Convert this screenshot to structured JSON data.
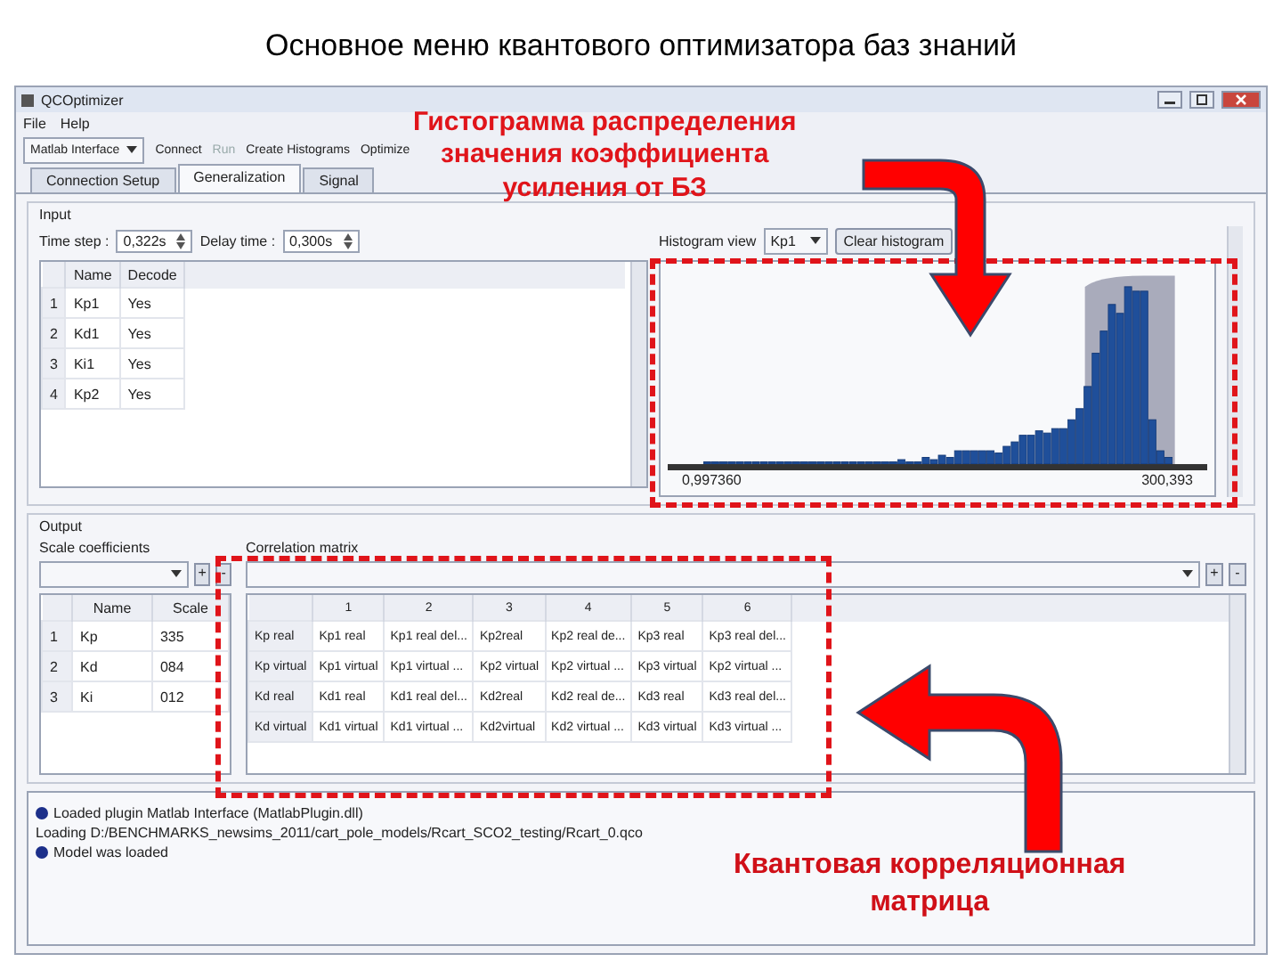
{
  "slide_title": "Основное меню квантового оптимизатора баз знаний",
  "annotations": [
    {
      "kind": "top",
      "lines": [
        "Гистограмма распределения",
        "значения коэффициента",
        "усиления от БЗ"
      ]
    },
    {
      "kind": "bottom",
      "lines": [
        "Квантовая корреляционная",
        "матрица"
      ]
    }
  ],
  "window": {
    "title": "QCOptimizer"
  },
  "menu": [
    "File",
    "Help"
  ],
  "toolbar": {
    "interface": "Matlab Interface",
    "actions": [
      {
        "label": "Connect",
        "disabled": false
      },
      {
        "label": "Run",
        "disabled": true
      },
      {
        "label": "Create Histograms",
        "disabled": false
      },
      {
        "label": "Optimize",
        "disabled": false
      }
    ]
  },
  "tabs": [
    {
      "label": "Connection Setup",
      "selected": false
    },
    {
      "label": "Generalization",
      "selected": true
    },
    {
      "label": "Signal",
      "selected": false
    }
  ],
  "input": {
    "title": "Input",
    "time_step_label": "Time step :",
    "time_step": "0,322s",
    "delay_label": "Delay time :",
    "delay": "0,300s",
    "columns": [
      "",
      "Name",
      "Decode"
    ],
    "rows": [
      [
        "1",
        "Kp1",
        "Yes"
      ],
      [
        "2",
        "Kd1",
        "Yes"
      ],
      [
        "3",
        "Ki1",
        "Yes"
      ],
      [
        "4",
        "Kp2",
        "Yes"
      ]
    ],
    "histogram_view_label": "Histogram view",
    "histogram_view": "Kp1",
    "clear_button": "Clear histogram",
    "x_min": "0,997360",
    "x_max": "300,393"
  },
  "output": {
    "title": "Output",
    "scale_label": "Scale coefficients",
    "matrix_label": "Correlation matrix",
    "plus": "+",
    "minus": "-",
    "scale_columns": [
      "",
      "Name",
      "Scale"
    ],
    "scale_rows": [
      [
        "1",
        "Kp",
        "335"
      ],
      [
        "2",
        "Kd",
        "084"
      ],
      [
        "3",
        "Ki",
        "012"
      ]
    ],
    "matrix_columns": [
      "",
      "1",
      "2",
      "3",
      "4",
      "5",
      "6"
    ],
    "matrix_rows": [
      [
        "Kp real",
        "Kp1 real",
        "Kp1 real del...",
        "Kp2real",
        "Kp2 real de...",
        "Kp3 real",
        "Kp3 real del..."
      ],
      [
        "Kp virtual",
        "Kp1 virtual",
        "Kp1 virtual ...",
        "Kp2 virtual",
        "Kp2 virtual ...",
        "Kp3 virtual",
        "Kp2 virtual ..."
      ],
      [
        "Kd real",
        "Kd1 real",
        "Kd1 real del...",
        "Kd2real",
        "Kd2 real de...",
        "Kd3 real",
        "Kd3 real del..."
      ],
      [
        "Kd virtual",
        "Kd1 virtual",
        "Kd1 virtual ...",
        "Kd2virtual",
        "Kd2 virtual ...",
        "Kd3 virtual",
        "Kd3 virtual ..."
      ]
    ]
  },
  "log": [
    {
      "kind": "info",
      "text": "Loaded plugin Matlab Interface (MatlabPlugin.dll)"
    },
    {
      "kind": "plain",
      "text": "Loading D:/BENCHMARKS_newsims_2011/cart_pole_models/Rcart_SCO2_testing/Rcart_0.qco"
    },
    {
      "kind": "info",
      "text": "Model was loaded"
    }
  ]
}
